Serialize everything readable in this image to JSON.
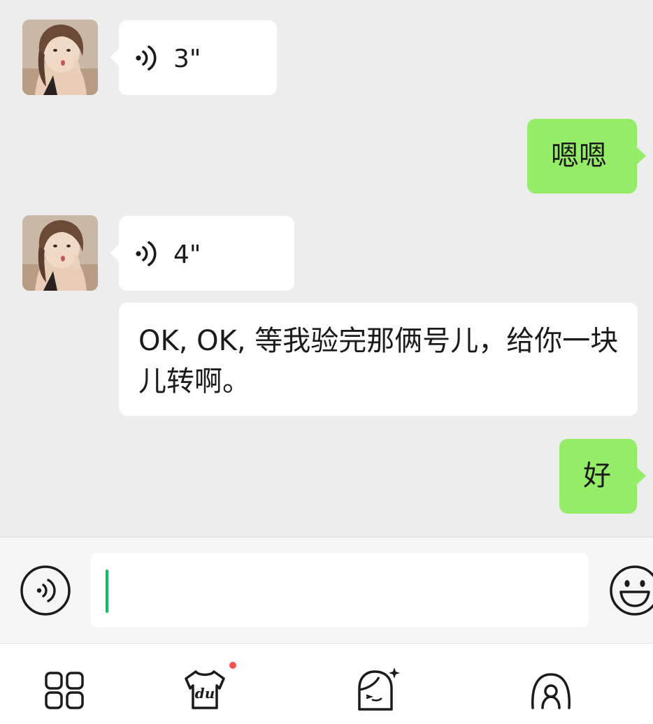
{
  "messages": [
    {
      "side": "in",
      "type": "voice",
      "duration": "3\""
    },
    {
      "side": "out",
      "type": "text",
      "text": "嗯嗯"
    },
    {
      "side": "in",
      "type": "voice",
      "duration": "4\""
    },
    {
      "side": "in",
      "type": "text",
      "text": "OK, OK, 等我验完那俩号儿，给你一块儿转啊。"
    },
    {
      "side": "out",
      "type": "text",
      "text": "好"
    }
  ],
  "input": {
    "value": "",
    "placeholder": ""
  },
  "icons": {
    "voice_toggle": "voice-icon",
    "emoji": "emoji-icon",
    "nav": [
      "grid-icon",
      "du-shirt-icon",
      "girl-sticker-icon",
      "headset-icon"
    ]
  },
  "colors": {
    "outgoing_bubble": "#95ec69",
    "incoming_bubble": "#ffffff",
    "background": "#ededed",
    "caret": "#07c160"
  }
}
